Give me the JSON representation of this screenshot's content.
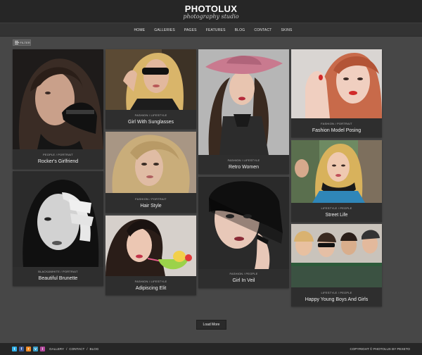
{
  "header": {
    "logo_title": "PHOTOLUX",
    "logo_subtitle": "photography studio"
  },
  "nav": {
    "items": [
      {
        "label": "HOME"
      },
      {
        "label": "GALLERIES"
      },
      {
        "label": "PAGES"
      },
      {
        "label": "FEATURES"
      },
      {
        "label": "BLOG"
      },
      {
        "label": "CONTACT"
      },
      {
        "label": "SKINS"
      }
    ]
  },
  "filter": {
    "label": "FILTER",
    "icon": "filter-list-icon"
  },
  "gallery": {
    "items": [
      {
        "category": "PEOPLE / PORTRAIT",
        "title": "Rocker's Girlfriend"
      },
      {
        "category": "BLACK&WHITE / PORTRAIT",
        "title": "Beautiful Brunette"
      },
      {
        "category": "FASHION / LIFESTYLE",
        "title": "Girl With Sunglasses"
      },
      {
        "category": "FASHION / PORTRAIT",
        "title": "Hair Style"
      },
      {
        "category": "FASHION / LIFESTYLE",
        "title": "Adipiscing Elit"
      },
      {
        "category": "FASHION / LIFESTYLE",
        "title": "Retro Women"
      },
      {
        "category": "FASHION / PEOPLE",
        "title": "Girl In Veil"
      },
      {
        "category": "FASHION / PORTRAIT",
        "title": "Fashion Model Posing"
      },
      {
        "category": "LIFESTYLE / PEOPLE",
        "title": "Street Life"
      },
      {
        "category": "LIFESTYLE / PEOPLE",
        "title": "Happy Young Boys And Girls"
      }
    ]
  },
  "load_more": {
    "label": "Load More"
  },
  "footer": {
    "social": [
      {
        "icon": "twitter-icon",
        "glyph": "t",
        "color": "#2fb0e8"
      },
      {
        "icon": "facebook-icon",
        "glyph": "f",
        "color": "#3b5a9a"
      },
      {
        "icon": "rss-icon",
        "glyph": "r",
        "color": "#f08a24"
      },
      {
        "icon": "vimeo-icon",
        "glyph": "v",
        "color": "#3aa0c9"
      },
      {
        "icon": "instagram-icon",
        "glyph": "i",
        "color": "#b2479c"
      }
    ],
    "links": [
      "GALLERY",
      "CONTACT",
      "BLOG"
    ],
    "separator": "/",
    "copyright": "COPYRIGHT © PHOTOLUX BY PEXETO"
  },
  "colors": {
    "background": "#474747",
    "header": "#262626",
    "card": "#2e2e2e"
  }
}
